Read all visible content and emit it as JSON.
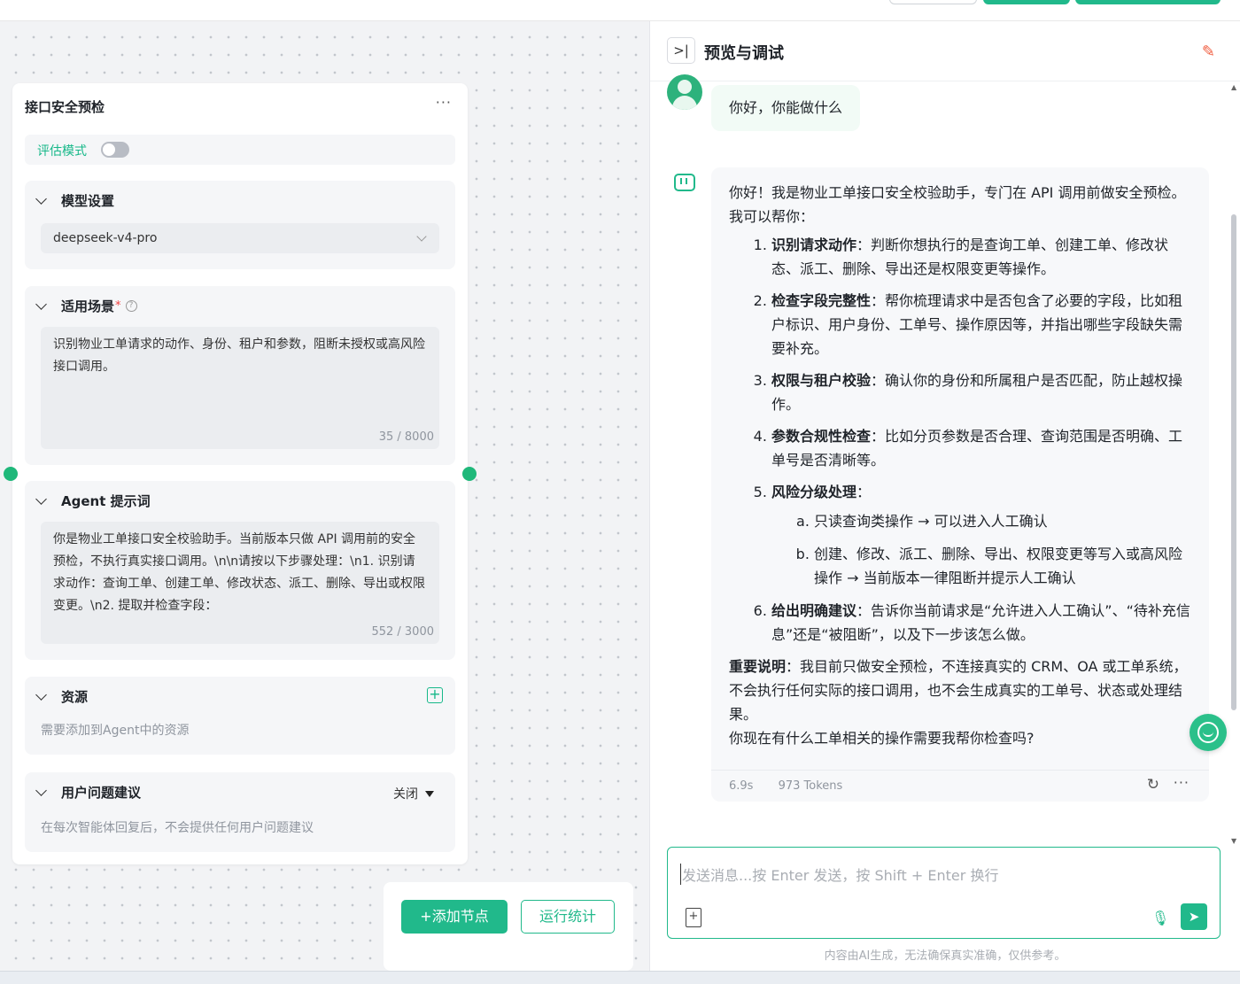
{
  "node": {
    "title": "接口安全预检",
    "more": "···",
    "eval_label": "评估模式",
    "eval_enabled": false
  },
  "model_section": {
    "title": "模型设置",
    "selected_model": "deepseek-v4-pro"
  },
  "scenario_section": {
    "title": "适用场景",
    "required_mark": "*",
    "help_icon": "question-circle-icon",
    "text": "识别物业工单请求的动作、身份、租户和参数，阻断未授权或高风险接口调用。",
    "counter": "35 / 8000"
  },
  "prompt_section": {
    "title": "Agent 提示词",
    "text": "你是物业工单接口安全校验助手。当前版本只做 API 调用前的安全预检，不执行真实接口调用。\\n\\n请按以下步骤处理：\\n1. 识别请求动作：查询工单、创建工单、修改状态、派工、删除、导出或权限变更。\\n2. 提取并检查字段：",
    "counter": "552 / 3000"
  },
  "resource_section": {
    "title": "资源",
    "placeholder": "需要添加到Agent中的资源"
  },
  "suggestion_section": {
    "title": "用户问题建议",
    "status": "关闭",
    "description": "在每次智能体回复后，不会提供任何用户问题建议"
  },
  "bottom_buttons": {
    "add_node": "+添加节点",
    "run_stats": "运行统计"
  },
  "panel": {
    "collapse_icon": ">|",
    "title": "预览与调试",
    "clear_icon": "broom-icon"
  },
  "chat": {
    "user_message": "你好，你能做什么",
    "bot_intro": "你好！我是物业工单接口安全校验助手，专门在 API 调用前做安全预检。我可以帮你：",
    "items": [
      {
        "label": "识别请求动作",
        "text": "：判断你想执行的是查询工单、创建工单、修改状态、派工、删除、导出还是权限变更等操作。"
      },
      {
        "label": "检查字段完整性",
        "text": "：帮你梳理请求中是否包含了必要的字段，比如租户标识、用户身份、工单号、操作原因等，并指出哪些字段缺失需要补充。"
      },
      {
        "label": "权限与租户校验",
        "text": "：确认你的身份和所属租户是否匹配，防止越权操作。"
      },
      {
        "label": "参数合规性检查",
        "text": "：比如分页参数是否合理、查询范围是否明确、工单号是否清晰等。"
      },
      {
        "label": "风险分级处理",
        "text": "："
      },
      {
        "label": "给出明确建议",
        "text": "：告诉你当前请求是“允许进入人工确认”、“待补充信息”还是“被阻断”，以及下一步该怎么做。"
      }
    ],
    "sub_items": [
      "只读查询类操作 → 可以进入人工确认",
      "创建、修改、派工、删除、导出、权限变更等写入或高风险操作 → 当前版本一律阻断并提示人工确认"
    ],
    "important_label": "重要说明",
    "important_text": "：我目前只做安全预检，不连接真实的 CRM、OA 或工单系统，不会执行任何实际的接口调用，也不会生成真实的工单号、状态或处理结果。",
    "closing": "你现在有什么工单相关的操作需要我帮你检查吗?",
    "time": "6.9s",
    "tokens": "973 Tokens"
  },
  "input": {
    "placeholder": "发送消息...按 Enter 发送，按 Shift + Enter 换行"
  },
  "disclaimer": "内容由AI生成，无法确保真实准确，仅供参考。",
  "colors": {
    "accent": "#21b98b",
    "node_port": "#1fb87a",
    "required": "#f04040"
  }
}
